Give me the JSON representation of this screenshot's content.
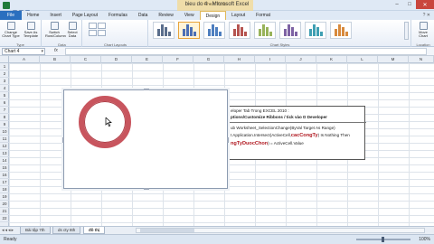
{
  "window": {
    "title": "bieu do 4 - Microsoft Excel",
    "context_tab_group": "Chart Tools"
  },
  "tabs": [
    "File",
    "Home",
    "Insert",
    "Page Layout",
    "Formulas",
    "Data",
    "Review",
    "View",
    "Design",
    "Layout",
    "Format"
  ],
  "active_tab": "Design",
  "ribbon": {
    "type": {
      "change_chart_type": "Change Chart Type",
      "save_as_template": "Save As Template",
      "label": "Type"
    },
    "data": {
      "switch_row_column": "Switch Row/Column",
      "select_data": "Select Data",
      "label": "Data"
    },
    "layouts_label": "Chart Layouts",
    "styles_label": "Chart Styles",
    "location": {
      "move_chart": "Move Chart",
      "label": "Location"
    },
    "style_colors": [
      "#5a6e8c",
      "#4c6fb4",
      "#4d7ebf",
      "#b55450",
      "#98b35a",
      "#7e63a4",
      "#3f9fb3",
      "#d88a3d"
    ],
    "selected_style_index": 1
  },
  "formula_bar": {
    "name_box": "Chart 4",
    "fx": "fx",
    "value": ""
  },
  "columns": [
    "A",
    "B",
    "C",
    "D",
    "E",
    "F",
    "G",
    "H",
    "I",
    "J",
    "K",
    "L",
    "M",
    "N"
  ],
  "rows": [
    "1",
    "2",
    "3",
    "4",
    "5",
    "6",
    "7",
    "8",
    "9",
    "10",
    "11",
    "12",
    "13",
    "14",
    "15",
    "16",
    "17",
    "18",
    "19",
    "20",
    "21",
    "22"
  ],
  "textbox": {
    "line1": "eloper Tab Trong EXCEL 2010 :",
    "line2": "ptions/Customize Ribbons / tick vào D Developer",
    "line3": "ub Worksheet_SelectionChange(ByVal Target As Range)",
    "line4a": "t Application.Intersect(ActiveCell,",
    "line4b": "cacCongTy",
    "line4c": ") Is Nothing Then",
    "line5a": "ngTyDuocChon",
    "line5b": ") = ActiveCell.Value"
  },
  "chart": {
    "ring_color": "#c8555e"
  },
  "sheets": [
    "Bài tập 7th",
    "ds cty 8th",
    "đồ thị"
  ],
  "active_sheet": 2,
  "status": {
    "ready": "Ready",
    "zoom": "100%"
  }
}
